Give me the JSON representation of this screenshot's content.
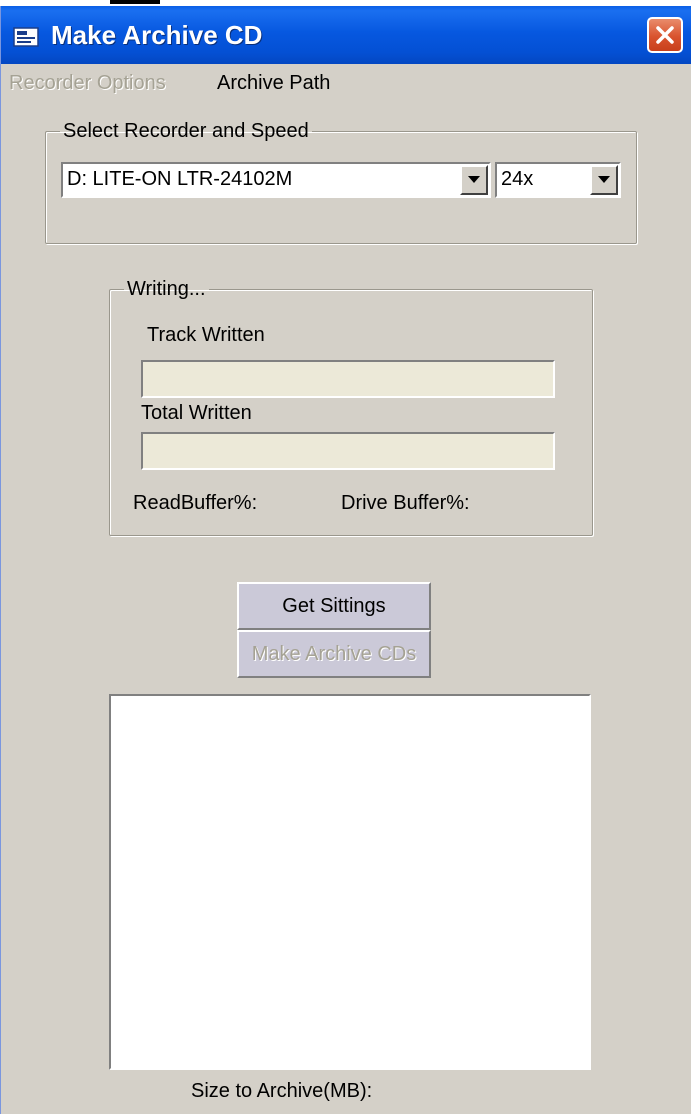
{
  "window": {
    "title": "Make Archive CD"
  },
  "menu": {
    "recorder_options": "Recorder Options",
    "archive_path": "Archive Path"
  },
  "recorder_group": {
    "legend": "Select Recorder and Speed",
    "recorder_value": "D: LITE-ON LTR-24102M",
    "speed_value": "24x"
  },
  "writing_group": {
    "legend": "Writing...",
    "track_written_label": "Track Written",
    "total_written_label": "Total Written",
    "read_buffer_label": "ReadBuffer%:",
    "drive_buffer_label": "Drive Buffer%:",
    "track_progress": 0,
    "total_progress": 0
  },
  "buttons": {
    "get_settings": "Get Sittings",
    "make_archive": "Make Archive CDs"
  },
  "footer": {
    "size_label": "Size to Archive(MB):"
  },
  "colors": {
    "titlebar": "#0758e0",
    "window_bg": "#d4d0c8",
    "close_button": "#d9532e"
  }
}
